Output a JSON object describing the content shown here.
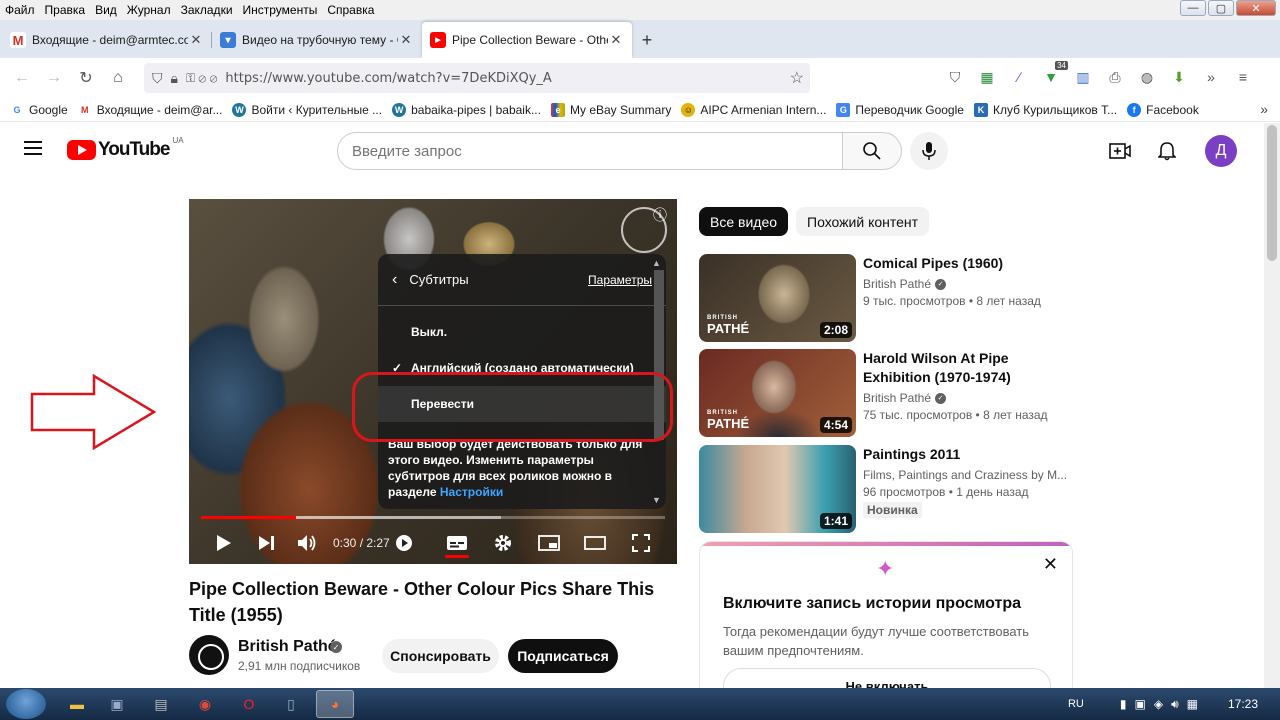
{
  "menubar": {
    "items": [
      "Файл",
      "Правка",
      "Вид",
      "Журнал",
      "Закладки",
      "Инструменты",
      "Справка"
    ]
  },
  "window_controls": {
    "minimize": "—",
    "maximize": "▢",
    "close": "✕"
  },
  "tabs": [
    {
      "label": "Входящие - deim@armtec.com",
      "icon": "gmail-icon",
      "close": "✕"
    },
    {
      "label": "Видео на трубочную тему - Cr",
      "icon": "site-icon",
      "close": "✕"
    },
    {
      "label": "Pipe Collection Beware - Othe",
      "icon": "youtube-icon",
      "close": "✕"
    }
  ],
  "newtab_label": "+",
  "tablist_label": "⌄",
  "nav": {
    "url": "https://www.youtube.com/watch?v=7DeKDiXQy_A"
  },
  "ext_badge": "34",
  "bookmarks": [
    {
      "label": "Google",
      "color": "#4285f4",
      "glyph": "G"
    },
    {
      "label": "Входящие - deim@ar...",
      "color": "#d93025",
      "glyph": "M"
    },
    {
      "label": "Войти ‹ Курительные ...",
      "color": "#21759b",
      "glyph": "W"
    },
    {
      "label": "babaika-pipes | babaik...",
      "color": "#21759b",
      "glyph": "W"
    },
    {
      "label": "My eBay Summary",
      "color": "#444",
      "glyph": "e"
    },
    {
      "label": "AIPC Armenian Intern...",
      "color": "#e5b400",
      "glyph": "☺"
    },
    {
      "label": "Переводчик Google",
      "color": "#4285f4",
      "glyph": "G"
    },
    {
      "label": "Клуб Курильщиков Т...",
      "color": "#2a6bb8",
      "glyph": "K"
    },
    {
      "label": "Facebook",
      "color": "#1877f2",
      "glyph": "f"
    }
  ],
  "bookmarks_more": "»",
  "youtube": {
    "logo_text": "YouTube",
    "region": "UA",
    "search_placeholder": "Введите запрос",
    "avatar_letter": "Д"
  },
  "player": {
    "time": "0:30 / 2:27",
    "progress_fraction": 0.204,
    "settings": {
      "back": "‹",
      "title": "Субтитры",
      "params_link": "Параметры",
      "items": [
        {
          "label": "Выкл.",
          "checked": false
        },
        {
          "label": "Английский (создано автоматически)",
          "checked": true
        },
        {
          "label": "Перевести",
          "checked": false
        }
      ],
      "note": "Ваш выбор будет действовать только для этого видео. Изменить параметры субтитров для всех роликов можно в разделе",
      "note_link": "Настройки"
    }
  },
  "video": {
    "title": "Pipe Collection Beware - Other Colour Pics Share This Title (1955)",
    "channel": "British Pathé",
    "subscribers": "2,91 млн подписчиков",
    "sponsor_label": "Спонсировать",
    "subscribe_label": "Подписаться"
  },
  "chips": [
    "Все видео",
    "Похожий контент"
  ],
  "recommendations": [
    {
      "title": "Comical Pipes (1960)",
      "channel": "British Pathé",
      "views": "9 тыс. просмотров",
      "age": "8 лет назад",
      "duration": "2:08",
      "brand": "PATHÉ",
      "brand_small": "BRITISH"
    },
    {
      "title": "Harold Wilson At Pipe Exhibition (1970-1974)",
      "channel": "British Pathé",
      "views": "75 тыс. просмотров",
      "age": "8 лет назад",
      "duration": "4:54",
      "brand": "PATHÉ",
      "brand_small": "BRITISH"
    },
    {
      "title": "Paintings 2011",
      "channel": "Films, Paintings and Craziness by M...",
      "views": "96 просмотров",
      "age": "1 день назад",
      "duration": "1:41",
      "badge": "Новинка"
    }
  ],
  "history_card": {
    "title": "Включите запись истории просмотра",
    "description": "Тогда рекомендации будут лучше соответствовать вашим предпочтениям.",
    "button": "Не включать"
  },
  "taskbar": {
    "lang": "RU",
    "time": "17:23"
  }
}
